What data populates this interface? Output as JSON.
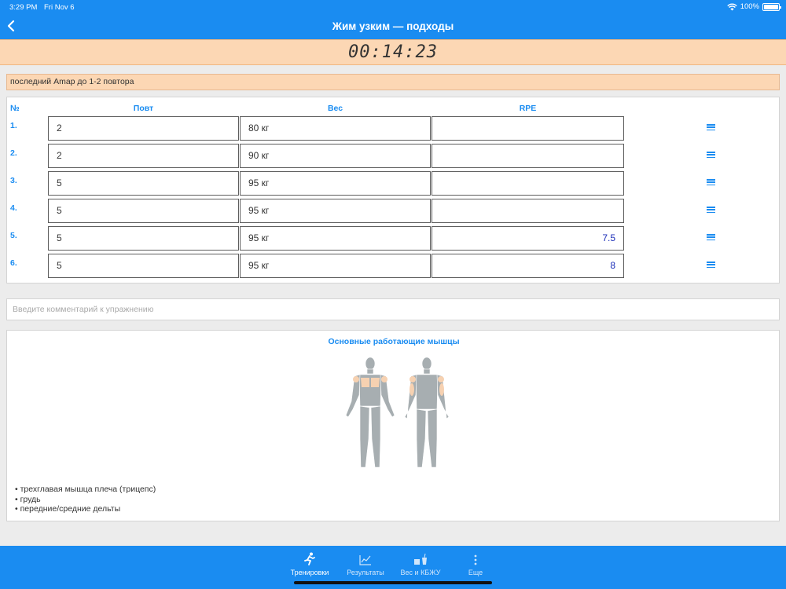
{
  "status_bar": {
    "time": "3:29 PM",
    "date": "Fri Nov 6",
    "battery": "100%"
  },
  "header": {
    "title": "Жим узким — подходы"
  },
  "timer": {
    "value": "00:14:23"
  },
  "note": {
    "text": "последний Amap до 1-2 повтора"
  },
  "sets": {
    "headers": {
      "num": "№",
      "reps": "Повт",
      "weight": "Вес",
      "rpe": "RPE"
    },
    "rows": [
      {
        "num": "1.",
        "reps": "2",
        "weight": "80 кг",
        "rpe": ""
      },
      {
        "num": "2.",
        "reps": "2",
        "weight": "90 кг",
        "rpe": ""
      },
      {
        "num": "3.",
        "reps": "5",
        "weight": "95 кг",
        "rpe": ""
      },
      {
        "num": "4.",
        "reps": "5",
        "weight": "95 кг",
        "rpe": ""
      },
      {
        "num": "5.",
        "reps": "5",
        "weight": "95 кг",
        "rpe": "7.5"
      },
      {
        "num": "6.",
        "reps": "5",
        "weight": "95 кг",
        "rpe": "8"
      }
    ]
  },
  "comment": {
    "placeholder": "Введите комментарий к упражнению"
  },
  "muscles": {
    "title": "Основные работающие мышцы",
    "items": [
      "трехглавая мышца плеча (трицепс)",
      "грудь",
      "передние/средние дельты"
    ]
  },
  "tabbar": {
    "tabs": [
      {
        "label": "Тренировки",
        "icon": "running-person-icon",
        "active": true
      },
      {
        "label": "Результаты",
        "icon": "chart-line-icon",
        "active": false
      },
      {
        "label": "Вес и КБЖУ",
        "icon": "scale-food-icon",
        "active": false
      },
      {
        "label": "Еще",
        "icon": "more-dots-icon",
        "active": false
      }
    ]
  },
  "colors": {
    "accent": "#1a8cf1",
    "highlight": "#fcd7b4",
    "rpe_text": "#1b2eb8",
    "muscle_gray": "#a7aeb1",
    "muscle_active": "#f6d1b1"
  }
}
